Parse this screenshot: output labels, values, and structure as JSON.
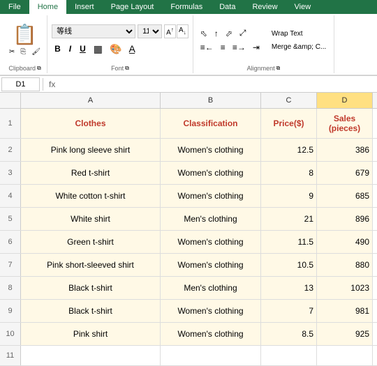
{
  "tabs": [
    "File",
    "Home",
    "Insert",
    "Page Layout",
    "Formulas",
    "Data",
    "Review",
    "View"
  ],
  "active_tab": "Home",
  "ribbon": {
    "clipboard": {
      "paste_label": "Paste",
      "cut_icon": "✂",
      "copy_icon": "⎘",
      "format_painter_icon": "🖌"
    },
    "font": {
      "font_name": "等线",
      "font_size": "11",
      "bold": "B",
      "italic": "I",
      "underline": "U",
      "inc_icon": "A↑",
      "dec_icon": "A↓"
    },
    "alignment": {
      "wrap_text": "Wrap Text",
      "merge": "Merge &amp; C..."
    },
    "groups": [
      "Clipboard",
      "Font",
      "Alignment"
    ]
  },
  "formula_bar": {
    "cell_ref": "D1",
    "formula": ""
  },
  "columns": [
    "A",
    "B",
    "C",
    "D"
  ],
  "headers": {
    "row_num": "",
    "col_a": "Clothes",
    "col_b": "Classification",
    "col_c": "Price($)",
    "col_d": "Sales\n(pieces)"
  },
  "rows": [
    {
      "num": "2",
      "a": "Pink long sleeve shirt",
      "b": "Women's clothing",
      "c": "12.5",
      "d": "386"
    },
    {
      "num": "3",
      "a": "Red t-shirt",
      "b": "Women's clothing",
      "c": "8",
      "d": "679"
    },
    {
      "num": "4",
      "a": "White cotton t-shirt",
      "b": "Women's clothing",
      "c": "9",
      "d": "685"
    },
    {
      "num": "5",
      "a": "White shirt",
      "b": "Men's clothing",
      "c": "21",
      "d": "896"
    },
    {
      "num": "6",
      "a": "Green t-shirt",
      "b": "Women's clothing",
      "c": "11.5",
      "d": "490"
    },
    {
      "num": "7",
      "a": "Pink short-sleeved shirt",
      "b": "Women's clothing",
      "c": "10.5",
      "d": "880"
    },
    {
      "num": "8",
      "a": "Black t-shirt",
      "b": "Men's clothing",
      "c": "13",
      "d": "1023"
    },
    {
      "num": "9",
      "a": "Black t-shirt",
      "b": "Women's clothing",
      "c": "7",
      "d": "981"
    },
    {
      "num": "10",
      "a": "Pink shirt",
      "b": "Women's clothing",
      "c": "8.5",
      "d": "925"
    }
  ],
  "empty_row": "11"
}
